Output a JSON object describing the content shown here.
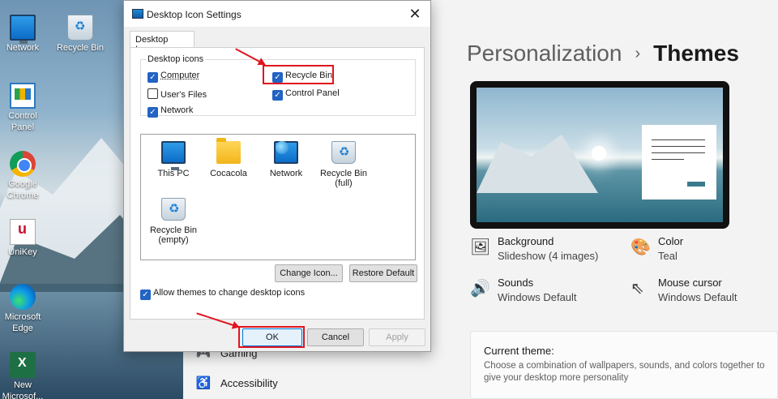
{
  "desktop": {
    "icons": [
      {
        "label": "Network",
        "icon": "network-icon"
      },
      {
        "label": "Recycle Bin",
        "icon": "recycle-bin-icon"
      },
      {
        "label": "Control Panel",
        "icon": "control-panel-icon"
      },
      {
        "label": "Google Chrome",
        "icon": "chrome-icon"
      },
      {
        "label": "UniKey",
        "icon": "unikey-icon"
      },
      {
        "label": "Microsoft Edge",
        "icon": "edge-icon"
      },
      {
        "label": "New Microsof...",
        "icon": "excel-icon"
      }
    ]
  },
  "settings": {
    "breadcrumb": {
      "parent": "Personalization",
      "separator": "›",
      "current": "Themes"
    },
    "items": [
      {
        "title": "Background",
        "value": "Slideshow (4 images)"
      },
      {
        "title": "Color",
        "value": "Teal"
      },
      {
        "title": "Sounds",
        "value": "Windows Default"
      },
      {
        "title": "Mouse cursor",
        "value": "Windows Default"
      }
    ],
    "current_theme": {
      "heading": "Current theme:",
      "description": "Choose a combination of wallpapers, sounds, and colors together to give your desktop more personality"
    },
    "nav": [
      {
        "label": "Gaming"
      },
      {
        "label": "Accessibility"
      }
    ]
  },
  "dialog": {
    "title": "Desktop Icon Settings",
    "close_glyph": "✕",
    "tab": "Desktop Icons",
    "group_label": "Desktop icons",
    "checkboxes": [
      {
        "label": "Computer",
        "checked": true
      },
      {
        "label": "User's Files",
        "checked": false
      },
      {
        "label": "Network",
        "checked": true
      },
      {
        "label": "Recycle Bin",
        "checked": true
      },
      {
        "label": "Control Panel",
        "checked": true
      }
    ],
    "list_items": [
      {
        "label": "This PC",
        "icon": "this-pc-icon"
      },
      {
        "label": "Cocacola",
        "icon": "folder-icon"
      },
      {
        "label": "Network",
        "icon": "network-icon"
      },
      {
        "label": "Recycle Bin",
        "sub": "(full)",
        "icon": "recycle-bin-full-icon"
      },
      {
        "label": "Recycle Bin",
        "sub": "(empty)",
        "icon": "recycle-bin-empty-icon"
      }
    ],
    "change_icon": "Change Icon...",
    "restore_default": "Restore Default",
    "allow_themes": {
      "label": "Allow themes to change desktop icons",
      "checked": true
    },
    "ok": "OK",
    "cancel": "Cancel",
    "apply": "Apply"
  },
  "colors": {
    "highlight": "#e0141e",
    "accent": "#2263c4"
  }
}
